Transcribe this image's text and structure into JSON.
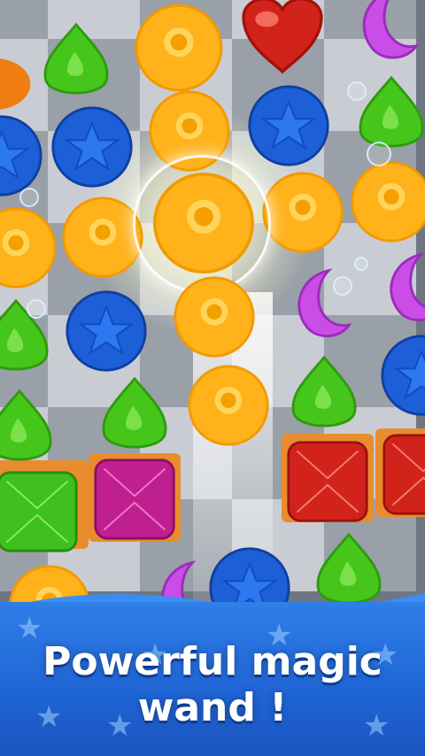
{
  "caption": {
    "line1": "Powerful magic",
    "line2": "wand !"
  },
  "colors": {
    "yellow": "#ffb21a",
    "blue": "#1d5fd6",
    "green": "#46c61b",
    "purple": "#c94de6",
    "red": "#d2231b",
    "magenta": "#c0208f",
    "banner": "#2f7fe8",
    "crate": "#e98c2d"
  },
  "gems": [
    {
      "row": 0,
      "col": 0,
      "kind": "orange-candy"
    },
    {
      "row": 0,
      "col": 1,
      "kind": "green-drop"
    },
    {
      "row": 0,
      "col": 2,
      "kind": "yellow-orb"
    },
    {
      "row": 0,
      "col": 3,
      "kind": "red-heart"
    },
    {
      "row": 0,
      "col": 4,
      "kind": "purple-moon"
    },
    {
      "row": 1,
      "col": 0,
      "kind": "blue-star"
    },
    {
      "row": 1,
      "col": 1,
      "kind": "blue-star"
    },
    {
      "row": 1,
      "col": 2,
      "kind": "yellow-orb"
    },
    {
      "row": 1,
      "col": 3,
      "kind": "blue-star"
    },
    {
      "row": 1,
      "col": 4,
      "kind": "green-drop"
    },
    {
      "row": 2,
      "col": 0,
      "kind": "yellow-orb"
    },
    {
      "row": 2,
      "col": 1,
      "kind": "yellow-orb"
    },
    {
      "row": 2,
      "col": 2,
      "kind": "yellow-orb"
    },
    {
      "row": 2,
      "col": 3,
      "kind": "yellow-orb"
    },
    {
      "row": 2,
      "col": 4,
      "kind": "yellow-orb"
    },
    {
      "row": 3,
      "col": 0,
      "kind": "green-drop"
    },
    {
      "row": 3,
      "col": 1,
      "kind": "blue-star"
    },
    {
      "row": 3,
      "col": 2,
      "kind": "yellow-orb"
    },
    {
      "row": 3,
      "col": 3,
      "kind": "purple-moon"
    },
    {
      "row": 3,
      "col": 4,
      "kind": "purple-moon"
    },
    {
      "row": 4,
      "col": 0,
      "kind": "green-drop"
    },
    {
      "row": 4,
      "col": 1,
      "kind": "green-drop"
    },
    {
      "row": 4,
      "col": 2,
      "kind": "yellow-orb"
    },
    {
      "row": 4,
      "col": 3,
      "kind": "green-drop"
    },
    {
      "row": 4,
      "col": 4,
      "kind": "blue-star"
    },
    {
      "row": 5,
      "col": 0,
      "kind": "green-square"
    },
    {
      "row": 5,
      "col": 1,
      "kind": "magenta-square"
    },
    {
      "row": 5,
      "col": 3,
      "kind": "red-square"
    },
    {
      "row": 5,
      "col": 4,
      "kind": "red-square"
    },
    {
      "row": 6,
      "col": 0,
      "kind": "yellow-orb"
    },
    {
      "row": 6,
      "col": 1,
      "kind": "purple-moon"
    },
    {
      "row": 6,
      "col": 2,
      "kind": "blue-star"
    },
    {
      "row": 6,
      "col": 3,
      "kind": "green-drop"
    }
  ]
}
